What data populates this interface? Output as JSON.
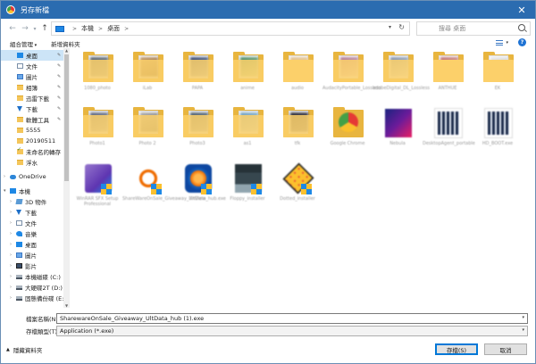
{
  "window": {
    "title": "另存新檔",
    "close_glyph": "✕"
  },
  "nav": {
    "back_glyph": "←",
    "forward_glyph": "→",
    "history_glyph": "▾",
    "up_glyph": "↑",
    "breadcrumb": [
      "本機",
      "桌面"
    ],
    "breadcrumb_sep": ">",
    "search_placeholder": "搜尋 桌面"
  },
  "toolbar": {
    "organize": "組合管理",
    "new_folder": "新增資料夾",
    "help": "?"
  },
  "sidebar": {
    "items": [
      {
        "label": "桌面",
        "icon": "folder-blue-icon",
        "pinned": true,
        "selected": true
      },
      {
        "label": "文件",
        "icon": "document-icon",
        "pinned": true
      },
      {
        "label": "圖片",
        "icon": "picture-icon",
        "pinned": true
      },
      {
        "label": "相簿",
        "icon": "folder-icon",
        "pinned": true
      },
      {
        "label": "迅雷下載",
        "icon": "folder-icon",
        "pinned": true
      },
      {
        "label": "下載",
        "icon": "download-icon",
        "pinned": true
      },
      {
        "label": "軟體工具",
        "icon": "folder-icon",
        "pinned": true
      },
      {
        "label": "5555",
        "icon": "folder-icon"
      },
      {
        "label": "20190511",
        "icon": "folder-icon"
      },
      {
        "label": "未命名的轉存",
        "icon": "check-folder-icon"
      },
      {
        "label": "浮水",
        "icon": "folder-icon"
      },
      {
        "label": "OneDrive",
        "icon": "cloud-icon",
        "section": true
      },
      {
        "label": "本機",
        "icon": "computer-icon",
        "section": true,
        "expanded": true
      },
      {
        "label": "3D 物件",
        "icon": "3d-objects-icon"
      },
      {
        "label": "下載",
        "icon": "download-icon"
      },
      {
        "label": "文件",
        "icon": "document-icon"
      },
      {
        "label": "音樂",
        "icon": "music-icon"
      },
      {
        "label": "桌面",
        "icon": "folder-blue-icon"
      },
      {
        "label": "圖片",
        "icon": "picture-icon"
      },
      {
        "label": "影片",
        "icon": "video-icon"
      },
      {
        "label": "本機磁碟 (C:)",
        "icon": "drive-icon"
      },
      {
        "label": "大硬碟2T (D:)",
        "icon": "drive-icon"
      },
      {
        "label": "固態備份碟 (E:)",
        "icon": "drive-icon"
      },
      {
        "label": "網路",
        "icon": "network-icon",
        "section": true
      }
    ]
  },
  "files": [
    {
      "type": "folder",
      "name": "1080_photo"
    },
    {
      "type": "folder",
      "name": "iLab"
    },
    {
      "type": "folder",
      "name": "PAPA"
    },
    {
      "type": "folder",
      "name": "anime"
    },
    {
      "type": "folder",
      "name": "audio"
    },
    {
      "type": "folder",
      "name": "AudacityPortable_Lossless"
    },
    {
      "type": "folder",
      "name": "adobeDigital_DL_Lossless"
    },
    {
      "type": "folder",
      "name": "ANTHUE"
    },
    {
      "type": "folder",
      "name": "EK"
    },
    {
      "type": "folder",
      "name": "Photo1"
    },
    {
      "type": "folder",
      "name": "Photo 2"
    },
    {
      "type": "folder",
      "name": "Photo3"
    },
    {
      "type": "folder",
      "name": "as1"
    },
    {
      "type": "folder",
      "name": "tfk"
    },
    {
      "type": "app",
      "name": "Google Chrome",
      "icon": "chrome-icon"
    },
    {
      "type": "app",
      "name": "Nebula",
      "icon": "app-icon"
    },
    {
      "type": "app",
      "name": "DesktopAgent_portable",
      "icon": "qr-icon"
    },
    {
      "type": "app",
      "name": "HD_BOOT.exe",
      "icon": "qr-icon"
    },
    {
      "type": "app",
      "name": "WinRAR SFX Setup Professional",
      "icon": "installer-icon"
    },
    {
      "type": "app",
      "name": "ShareWareOnSale_Giveaway_UltData_hub.exe",
      "icon": "update-icon"
    },
    {
      "type": "app",
      "name": "XnView",
      "icon": "xnview-icon"
    },
    {
      "type": "app",
      "name": "Floppy_installer",
      "icon": "floppy-icon"
    },
    {
      "type": "app",
      "name": "Dotted_installer",
      "icon": "dotted-icon"
    }
  ],
  "form": {
    "filename_label": "檔案名稱(N):",
    "filename_value": "SharewareOnSale_Giveaway_UltData_hub (1).exe",
    "filetype_label": "存檔類型(T):",
    "filetype_value": "Application (*.exe)",
    "hide_folders": "隱藏資料夾",
    "save": "存檔(S)",
    "cancel": "取消"
  },
  "colors": {
    "accent": "#0078d7",
    "selection": "#cce4f7",
    "titlebar": "#2b6cb0",
    "folder": "#fcd06a"
  }
}
